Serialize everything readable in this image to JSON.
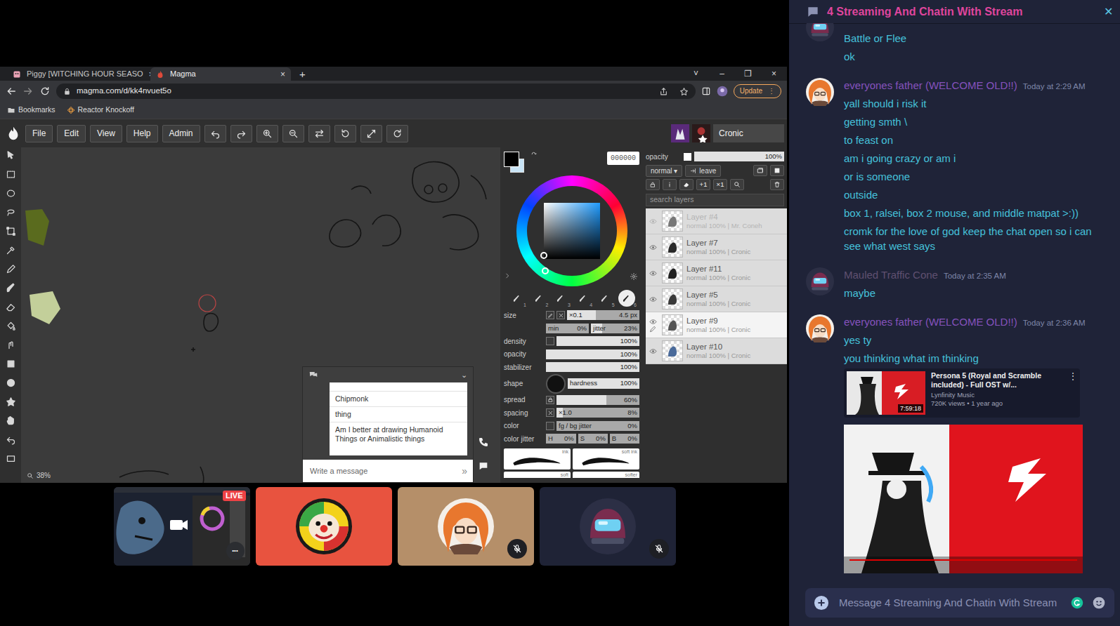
{
  "browser": {
    "tabs": [
      {
        "label": "Piggy [WITCHING HOUR SEASO",
        "close": "×",
        "selected": false
      },
      {
        "label": "Magma",
        "close": "×",
        "selected": true
      }
    ],
    "new_tab": "+",
    "window_controls": [
      "˅",
      "–",
      "❐",
      "×"
    ],
    "url": "magma.com/d/kk4nvuet5o",
    "update": {
      "label": "Update",
      "menu": "⋮"
    },
    "bookmarks": [
      "Bookmarks",
      "Reactor Knockoff"
    ]
  },
  "magma": {
    "menu": [
      "File",
      "Edit",
      "View",
      "Help",
      "Admin"
    ],
    "user": "Cronic",
    "zoom": "38%",
    "chat": {
      "caret": "⌄",
      "messages": [
        "Chipmonk",
        "thing",
        "Am I better at drawing Humanoid Things or Animalistic things"
      ],
      "placeholder": "Write a message",
      "send": "»"
    },
    "color": {
      "hex": "000000",
      "foreground": "#000000",
      "background": "#c8e4f6"
    },
    "brushes": [
      {
        "label": "1",
        "selected": false
      },
      {
        "label": "2",
        "selected": false
      },
      {
        "label": "3",
        "selected": false
      },
      {
        "label": "4",
        "selected": false
      },
      {
        "label": "5",
        "selected": false
      },
      {
        "label": "6",
        "selected": true
      }
    ],
    "settings": [
      {
        "kind": "slider",
        "label": "size",
        "toggles": [
          "pressure",
          "cross"
        ],
        "fields": [
          {
            "text": "×0.1",
            "value": "4.5 px",
            "level": 0.4
          }
        ]
      },
      {
        "kind": "slider",
        "fields": [
          {
            "text": "min",
            "value": "0%",
            "level": 0
          },
          {
            "text": "jitter",
            "value": "23%",
            "level": 0.23
          }
        ]
      },
      {
        "kind": "slider",
        "label": "density",
        "toggles": [
          "box"
        ],
        "fields": [
          {
            "value": "100%",
            "level": 1
          }
        ]
      },
      {
        "kind": "slider",
        "label": "opacity",
        "fields": [
          {
            "value": "100%",
            "level": 1
          }
        ]
      },
      {
        "kind": "slider",
        "label": "stabilizer",
        "fields": [
          {
            "value": "100%",
            "level": 1
          }
        ]
      },
      {
        "kind": "shape",
        "label": "shape",
        "fields": [
          {
            "text": "hardness",
            "value": "100%",
            "level": 1
          }
        ]
      },
      {
        "kind": "slider",
        "label": "spread",
        "toggles": [
          "lock"
        ],
        "fields": [
          {
            "value": "60%",
            "level": 0.6
          }
        ]
      },
      {
        "kind": "slider",
        "label": "spacing",
        "toggles": [
          "cross"
        ],
        "fields": [
          {
            "text": "×1.0",
            "value": "8%",
            "level": 0.08
          }
        ]
      },
      {
        "kind": "slider",
        "label": "color",
        "toggles": [
          "box"
        ],
        "fields": [
          {
            "text": "fg / bg jitter",
            "value": "0%",
            "level": 0
          }
        ]
      },
      {
        "kind": "slider",
        "label": "color jitter",
        "fields": [
          {
            "text": "H",
            "value": "0%",
            "level": 0
          },
          {
            "text": "S",
            "value": "0%",
            "level": 0
          },
          {
            "text": "B",
            "value": "0%",
            "level": 0
          }
        ]
      }
    ],
    "brush_tiles": [
      "ink",
      "soft ink",
      "soft",
      "softer"
    ],
    "layers": {
      "opacity_label": "opacity",
      "opacity": "100%",
      "opacity_level": 1,
      "blend": "normal ▾",
      "leave": "leave",
      "buttons": [
        "+1",
        "×1"
      ],
      "search_placeholder": "search layers",
      "items": [
        {
          "name": "Layer #4",
          "meta": "normal 100% | Mr. Coneh",
          "visible": false,
          "selected": false
        },
        {
          "name": "Layer #7",
          "meta": "normal 100% | Cronic",
          "visible": true,
          "selected": false
        },
        {
          "name": "Layer #11",
          "meta": "normal 100% | Cronic",
          "visible": true,
          "selected": false
        },
        {
          "name": "Layer #5",
          "meta": "normal 100% | Cronic",
          "visible": true,
          "selected": false
        },
        {
          "name": "Layer #9",
          "meta": "normal 100% | Cronic",
          "visible": true,
          "selected": true
        },
        {
          "name": "Layer #10",
          "meta": "normal 100% | Cronic",
          "visible": true,
          "selected": false
        }
      ]
    }
  },
  "call": {
    "tiles": [
      {
        "kind": "stream",
        "live": "LIVE",
        "more": "•••",
        "color": "#1c2230",
        "muted": false
      },
      {
        "kind": "avatar",
        "color": "#e8533f",
        "muted": false
      },
      {
        "kind": "avatar",
        "color": "#b58f69",
        "muted": true
      },
      {
        "kind": "avatar",
        "color": "#1f2336",
        "muted": true
      }
    ]
  },
  "chat": {
    "title": "4 Streaming And Chatin With Stream",
    "close": "✕",
    "groups": [
      {
        "lines": [
          "Battle or Flee",
          "ok"
        ]
      },
      {
        "author": "everyones father (WELCOME OLD!!)",
        "time": "Today at 2:29 AM",
        "color": "#8552bd",
        "lines": [
          "yall should i risk it",
          "getting smth \\",
          "to feast on",
          "am i going crazy or am i",
          "or is someone",
          "outside",
          "box 1, ralsei, box 2 mouse, and middle matpat >:))",
          "cromk for the love of god keep the chat open so i can see what west says"
        ]
      },
      {
        "author": "Mauled Traffic Cone",
        "time": "Today at 2:35 AM",
        "color": "#5f5070",
        "lines": [
          "maybe"
        ]
      },
      {
        "author": "everyones father (WELCOME OLD!!)",
        "time": "Today at 2:36 AM",
        "color": "#8552bd",
        "lines": [
          "yes ty",
          "you thinking what im thinking"
        ],
        "embed": {
          "title": "Persona 5 (Royal and Scramble included) - Full OST w/...",
          "channel": "Lynfinity Music",
          "stats": "720K views • 1 year ago",
          "duration": "7:59:18",
          "menu": "⋮"
        }
      }
    ],
    "placeholder": "Message 4 Streaming And Chatin With Stream"
  }
}
